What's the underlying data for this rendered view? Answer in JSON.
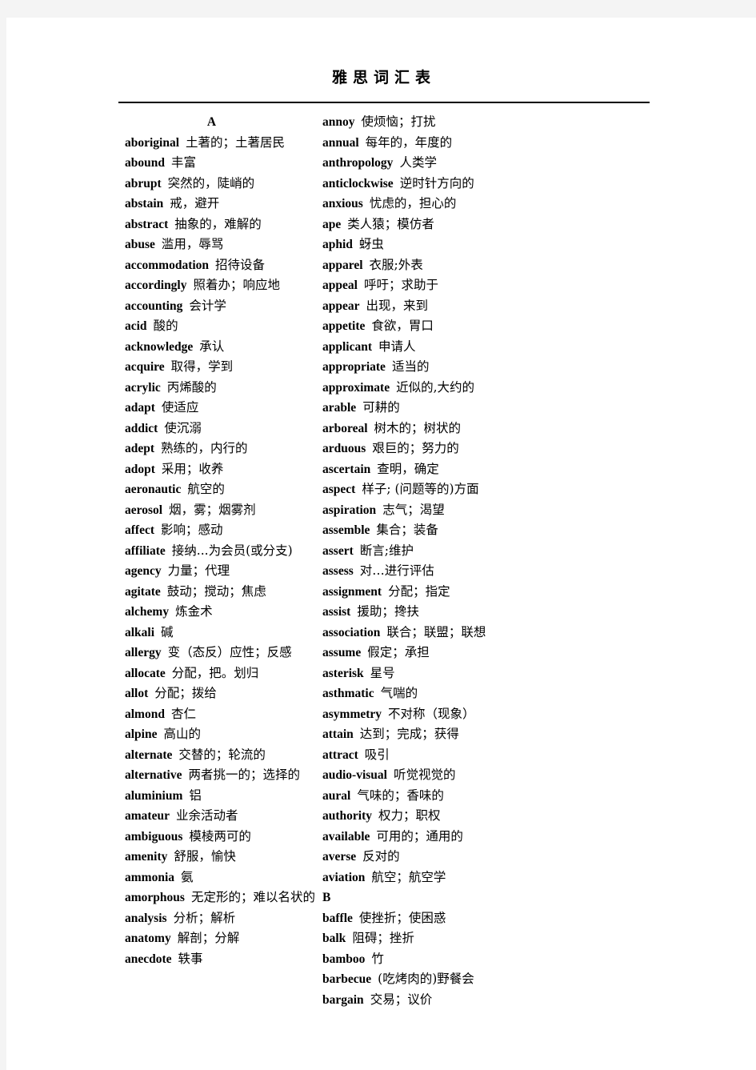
{
  "document": {
    "title": "雅思词汇表"
  },
  "columns": {
    "left": {
      "letter_heading": "A",
      "entries": [
        {
          "word": "aboriginal",
          "gloss": "土著的；土著居民"
        },
        {
          "word": "abound",
          "gloss": "丰富"
        },
        {
          "word": "abrupt",
          "gloss": "突然的，陡峭的"
        },
        {
          "word": "abstain",
          "gloss": "戒，避开"
        },
        {
          "word": "abstract",
          "gloss": "抽象的，难解的"
        },
        {
          "word": "abuse",
          "gloss": "滥用，辱骂"
        },
        {
          "word": "accommodation",
          "gloss": "招待设备"
        },
        {
          "word": "accordingly",
          "gloss": "照着办；响应地"
        },
        {
          "word": "accounting",
          "gloss": "会计学"
        },
        {
          "word": "acid",
          "gloss": "酸的"
        },
        {
          "word": "acknowledge",
          "gloss": "承认"
        },
        {
          "word": "acquire",
          "gloss": "取得，学到"
        },
        {
          "word": "acrylic",
          "gloss": "丙烯酸的"
        },
        {
          "word": "adapt",
          "gloss": "使适应"
        },
        {
          "word": "addict",
          "gloss": "使沉溺"
        },
        {
          "word": "adept",
          "gloss": "熟练的，内行的"
        },
        {
          "word": "adopt",
          "gloss": "采用；收养"
        },
        {
          "word": "aeronautic",
          "gloss": "航空的"
        },
        {
          "word": "aerosol",
          "gloss": "烟，雾；烟雾剂"
        },
        {
          "word": "affect",
          "gloss": "影响；感动"
        },
        {
          "word": "affiliate",
          "gloss": "接纳...为会员(或分支)"
        },
        {
          "word": "agency",
          "gloss": "力量；代理"
        },
        {
          "word": "agitate",
          "gloss": "鼓动；搅动；焦虑"
        },
        {
          "word": "alchemy",
          "gloss": "炼金术"
        },
        {
          "word": "alkali",
          "gloss": "碱"
        },
        {
          "word": "allergy",
          "gloss": "变（态反）应性；反感"
        },
        {
          "word": "allocate",
          "gloss": "分配，把。划归"
        },
        {
          "word": "allot",
          "gloss": "分配；拨给"
        },
        {
          "word": "almond",
          "gloss": "杏仁"
        },
        {
          "word": "alpine",
          "gloss": "高山的"
        },
        {
          "word": "alternate",
          "gloss": "交替的；轮流的"
        },
        {
          "word": "alternative",
          "gloss": "两者挑一的；选择的"
        },
        {
          "word": "aluminium",
          "gloss": "铝"
        },
        {
          "word": "amateur",
          "gloss": "业余活动者"
        },
        {
          "word": "ambiguous",
          "gloss": "模棱两可的"
        },
        {
          "word": "amenity",
          "gloss": "舒服，愉快"
        },
        {
          "word": "ammonia",
          "gloss": "氨"
        },
        {
          "word": "amorphous",
          "gloss": "无定形的；难以名状的"
        },
        {
          "word": "analysis",
          "gloss": "分析；解析"
        },
        {
          "word": "anatomy",
          "gloss": "解剖；分解"
        },
        {
          "word": "anecdote",
          "gloss": "轶事"
        }
      ]
    },
    "right": {
      "letter_heading": "B",
      "entries_before_heading": [
        {
          "word": "annoy",
          "gloss": "使烦恼；打扰"
        },
        {
          "word": "annual",
          "gloss": "每年的，年度的"
        },
        {
          "word": "anthropology",
          "gloss": "人类学"
        },
        {
          "word": "anticlockwise",
          "gloss": "逆时针方向的"
        },
        {
          "word": "anxious",
          "gloss": "忧虑的，担心的"
        },
        {
          "word": "ape",
          "gloss": "类人猿；模仿者"
        },
        {
          "word": "aphid",
          "gloss": "蚜虫"
        },
        {
          "word": "apparel",
          "gloss": "衣服;外表"
        },
        {
          "word": "appeal",
          "gloss": "呼吁；求助于"
        },
        {
          "word": "appear",
          "gloss": "出现，来到"
        },
        {
          "word": "appetite",
          "gloss": "食欲，胃口"
        },
        {
          "word": "applicant",
          "gloss": "申请人"
        },
        {
          "word": "appropriate",
          "gloss": "适当的"
        },
        {
          "word": "approximate",
          "gloss": "近似的,大约的"
        },
        {
          "word": "arable",
          "gloss": "可耕的"
        },
        {
          "word": "arboreal",
          "gloss": "树木的；树状的"
        },
        {
          "word": "arduous",
          "gloss": "艰巨的；努力的"
        },
        {
          "word": "ascertain",
          "gloss": "查明，确定"
        },
        {
          "word": "aspect",
          "gloss": "样子; (问题等的)方面"
        },
        {
          "word": "aspiration",
          "gloss": "志气；渴望"
        },
        {
          "word": "assemble",
          "gloss": "集合；装备"
        },
        {
          "word": "assert",
          "gloss": "断言;维护"
        },
        {
          "word": "assess",
          "gloss": "对…进行评估"
        },
        {
          "word": "assignment",
          "gloss": "分配；指定"
        },
        {
          "word": "assist",
          "gloss": "援助；搀扶"
        },
        {
          "word": "association",
          "gloss": "联合；联盟；联想"
        },
        {
          "word": "assume",
          "gloss": "假定；承担"
        },
        {
          "word": "asterisk",
          "gloss": "星号"
        },
        {
          "word": "asthmatic",
          "gloss": "气喘的"
        },
        {
          "word": "asymmetry",
          "gloss": "不对称（现象）"
        },
        {
          "word": "attain",
          "gloss": "达到；完成；获得"
        },
        {
          "word": "attract",
          "gloss": "吸引"
        },
        {
          "word": "audio-visual",
          "gloss": "听觉视觉的"
        },
        {
          "word": "aural",
          "gloss": "气味的；香味的"
        },
        {
          "word": "authority",
          "gloss": "权力；职权"
        },
        {
          "word": "available",
          "gloss": "可用的；通用的"
        },
        {
          "word": "averse",
          "gloss": "反对的"
        },
        {
          "word": "aviation",
          "gloss": "航空；航空学"
        }
      ],
      "entries_after_heading": [
        {
          "word": "baffle",
          "gloss": "使挫折；使困惑"
        },
        {
          "word": "balk",
          "gloss": "阻碍；挫折"
        },
        {
          "word": "bamboo",
          "gloss": "竹"
        },
        {
          "word": "barbecue",
          "gloss": "(吃烤肉的)野餐会"
        },
        {
          "word": "bargain",
          "gloss": "交易；议价"
        }
      ]
    }
  }
}
